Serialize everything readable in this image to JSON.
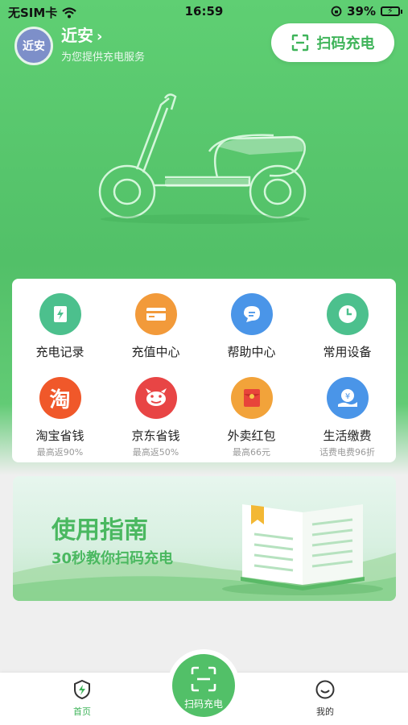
{
  "status_bar": {
    "carrier": "无SIM卡",
    "time": "16:59",
    "battery": "39%"
  },
  "header": {
    "avatar_text": "近安",
    "city": "近安",
    "subtitle": "为您提供充电服务",
    "scan_button": "扫码充电"
  },
  "menu": {
    "items": [
      {
        "label": "充电记录",
        "icon": "bolt-record-icon",
        "color": "#4cc08d"
      },
      {
        "label": "充值中心",
        "icon": "card-icon",
        "color": "#f29a3a"
      },
      {
        "label": "帮助中心",
        "icon": "chat-icon",
        "color": "#4a95e8"
      },
      {
        "label": "常用设备",
        "icon": "clock-icon",
        "color": "#4cc08d"
      },
      {
        "label": "淘宝省钱",
        "hint": "最高返90%",
        "icon": "taobao-icon",
        "color": "#f0582a"
      },
      {
        "label": "京东省钱",
        "hint": "最高返50%",
        "icon": "jd-icon",
        "color": "#e84545"
      },
      {
        "label": "外卖红包",
        "hint": "最高66元",
        "icon": "red-envelope-icon",
        "color": "#f2a33a"
      },
      {
        "label": "生活缴费",
        "hint": "话费电费96折",
        "icon": "bill-pay-icon",
        "color": "#4a95e8"
      }
    ]
  },
  "guide": {
    "title": "使用指南",
    "subtitle": "30秒教你扫码充电"
  },
  "tabbar": {
    "home": "首页",
    "scan": "扫码充电",
    "mine": "我的",
    "active_color": "#3fb45a"
  }
}
